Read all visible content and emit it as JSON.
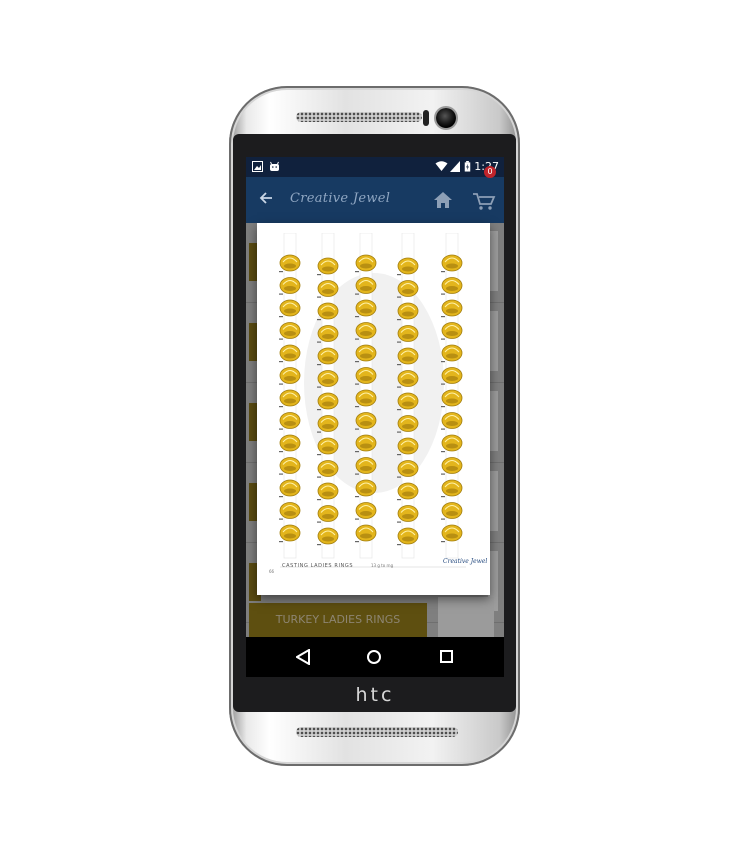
{
  "device": {
    "brand": "htc"
  },
  "status_bar": {
    "time": "1:27",
    "left_icons": [
      "image-notification-icon",
      "android-notification-icon"
    ],
    "right_icons": [
      "wifi-icon",
      "signal-icon",
      "battery-charging-icon"
    ]
  },
  "app_bar": {
    "brand_name": "Creative Jewel",
    "back_icon": "arrow-left-icon",
    "home_icon": "home-icon",
    "cart_icon": "cart-icon",
    "cart_count": "0"
  },
  "colors": {
    "status_bar": "#10213d",
    "app_bar": "#173a62",
    "gold": "#e3b51c",
    "badge": "#c0242b"
  },
  "dialog": {
    "catalog": {
      "footer_title": "CASTING LADIES RINGS",
      "logo_text": "Creative Jewel",
      "page_number": "66",
      "weight_note": "13 g to rng"
    }
  },
  "list": {
    "visible_item_label": "TURKEY LADIES RINGS"
  },
  "nav_bar": {
    "icons": [
      "back-triangle-icon",
      "home-circle-icon",
      "recents-square-icon"
    ]
  }
}
